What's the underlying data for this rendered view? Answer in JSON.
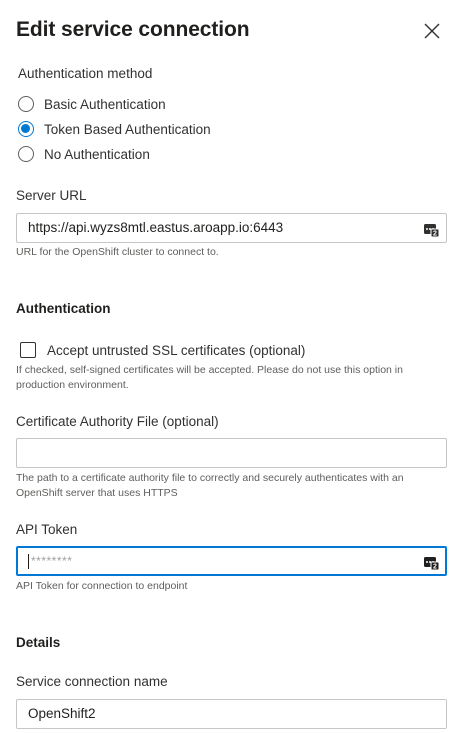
{
  "panel": {
    "title": "Edit service connection",
    "close_icon": "close-icon"
  },
  "auth_method": {
    "label": "Authentication method",
    "options": [
      {
        "label": "Basic Authentication",
        "checked": false
      },
      {
        "label": "Token Based Authentication",
        "checked": true
      },
      {
        "label": "No Authentication",
        "checked": false
      }
    ]
  },
  "server_url": {
    "label": "Server URL",
    "value": "https://api.wyzs8mtl.eastus.aroapp.io:6443",
    "helper": "URL for the OpenShift cluster to connect to.",
    "icon": "key-vault-icon"
  },
  "authentication": {
    "heading": "Authentication",
    "accept_untrusted": {
      "label": "Accept untrusted SSL certificates (optional)",
      "checked": false,
      "helper": "If checked, self-signed certificates will be accepted. Please do not use this option in production environment."
    },
    "ca_file": {
      "label": "Certificate Authority File (optional)",
      "value": "",
      "helper": "The path to a certificate authority file to correctly and securely authenticates with an OpenShift server that uses HTTPS"
    },
    "api_token": {
      "label": "API Token",
      "placeholder": "********",
      "helper": "API Token for connection to endpoint",
      "icon": "key-vault-icon"
    }
  },
  "details": {
    "heading": "Details",
    "name_label": "Service connection name",
    "name_value": "OpenShift2"
  },
  "colors": {
    "accent": "#0078d4",
    "border": "#c8c6c4",
    "helper_text": "#605e5c"
  }
}
